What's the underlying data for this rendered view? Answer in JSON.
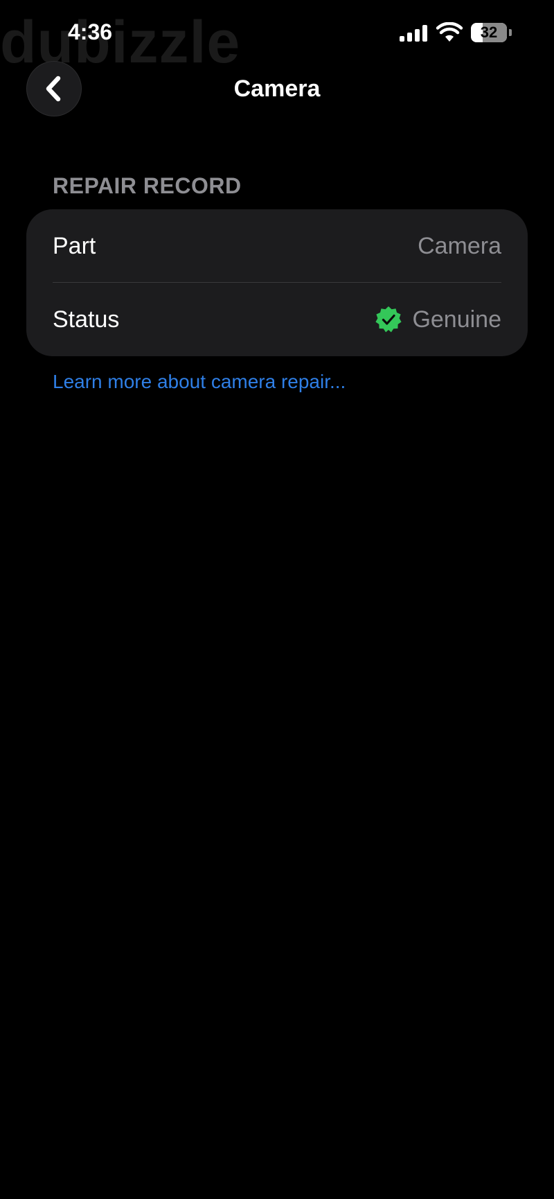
{
  "watermark": {
    "text": "dubizzle"
  },
  "status_bar": {
    "time": "4:36",
    "signal_icon": "cellular-signal-icon",
    "wifi_icon": "wifi-icon",
    "battery_level": "32",
    "battery_fraction": 0.32
  },
  "nav": {
    "back_icon": "chevron-left-icon",
    "title": "Camera"
  },
  "repair_record": {
    "section_title": "REPAIR RECORD",
    "rows": [
      {
        "label": "Part",
        "value": "Camera"
      },
      {
        "label": "Status",
        "value": "Genuine",
        "badge_icon": "verified-check-badge-icon"
      }
    ],
    "link": "Learn more about camera repair..."
  },
  "colors": {
    "background": "#000000",
    "card": "#1c1c1e",
    "secondary_text": "#8e8e93",
    "link": "#2f7fe6",
    "badge_green": "#34c759"
  }
}
